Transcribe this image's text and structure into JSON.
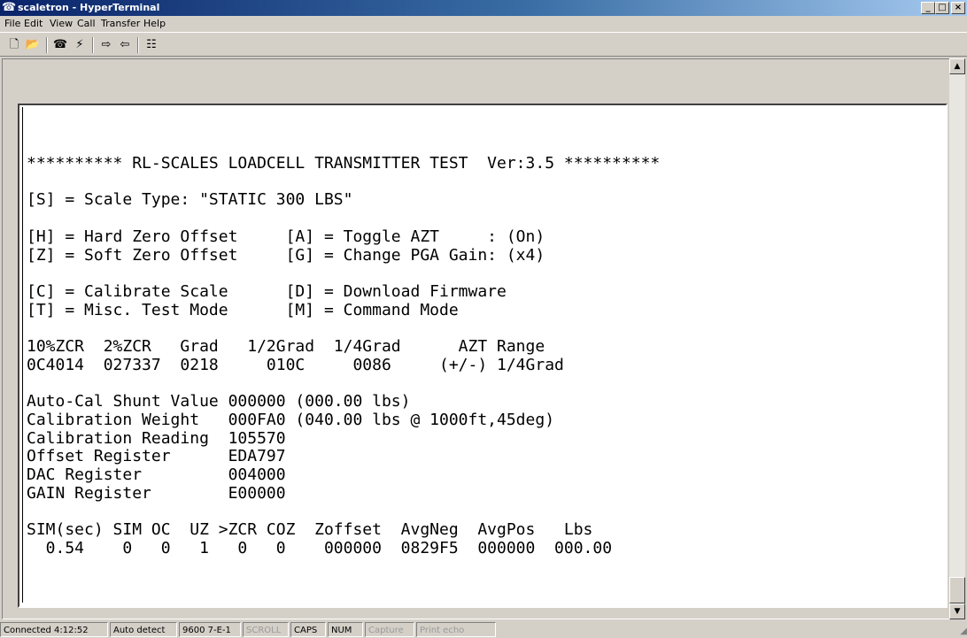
{
  "window": {
    "title": "scaletron - HyperTerminal",
    "controls": [
      "_",
      "□",
      "×"
    ]
  },
  "menu": [
    "File",
    "Edit",
    "View",
    "Call",
    "Transfer",
    "Help"
  ],
  "toolbar": {
    "buttons": [
      "new-icon",
      "open-icon",
      "connect-icon",
      "disconnect-icon",
      "send-icon",
      "receive-icon",
      "properties-icon"
    ]
  },
  "terminal": {
    "lines": [
      "********** RL-SCALES LOADCELL TRANSMITTER TEST  Ver:3.5 **********",
      "",
      "[S] = Scale Type: \"STATIC 300 LBS\"",
      "",
      "[H] = Hard Zero Offset     [A] = Toggle AZT     : (On)",
      "[Z] = Soft Zero Offset     [G] = Change PGA Gain: (x4)",
      "",
      "[C] = Calibrate Scale      [D] = Download Firmware",
      "[T] = Misc. Test Mode      [M] = Command Mode",
      "",
      "10%ZCR  2%ZCR   Grad   1/2Grad  1/4Grad      AZT Range",
      "0C4014  027337  0218     010C     0086     (+/-) 1/4Grad",
      "",
      "Auto-Cal Shunt Value 000000 (000.00 lbs)",
      "Calibration Weight   000FA0 (040.00 lbs @ 1000ft,45deg)",
      "Calibration Reading  105570",
      "Offset Register      EDA797",
      "DAC Register         004000",
      "GAIN Register        E00000",
      "",
      "SIM(sec) SIM OC  UZ >ZCR COZ  Zoffset  AvgNeg  AvgPos   Lbs",
      "  0.54    0   0   1   0   0    000000  0829F5  000000  000.00"
    ]
  },
  "status": {
    "connection": "Connected 4:12:52",
    "detect": "Auto detect",
    "settings": "9600 7-E-1",
    "scroll": "SCROLL",
    "caps": "CAPS",
    "num": "NUM",
    "capture": "Capture",
    "print_echo": "Print echo"
  }
}
